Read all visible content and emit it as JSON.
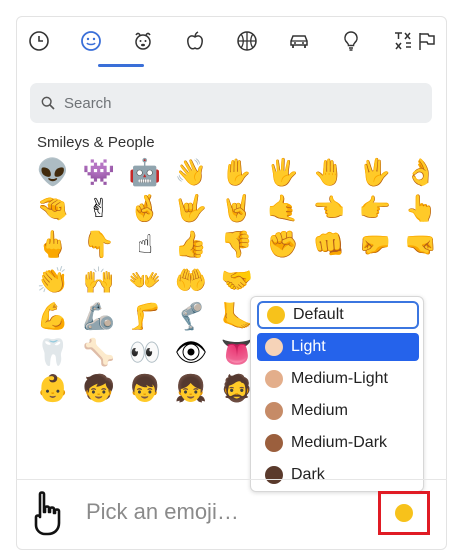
{
  "categories": [
    {
      "name": "recent-icon",
      "label": "Recent"
    },
    {
      "name": "smiley-icon",
      "label": "Smileys & People",
      "active": true
    },
    {
      "name": "animal-icon",
      "label": "Animals & Nature"
    },
    {
      "name": "food-icon",
      "label": "Food & Drink"
    },
    {
      "name": "activity-icon",
      "label": "Activity"
    },
    {
      "name": "travel-icon",
      "label": "Travel & Places"
    },
    {
      "name": "objects-icon",
      "label": "Objects"
    },
    {
      "name": "symbols-icon",
      "label": "Symbols"
    },
    {
      "name": "flags-icon",
      "label": "Flags"
    }
  ],
  "search": {
    "placeholder": "Search"
  },
  "section_title": "Smileys & People",
  "emoji_rows": [
    [
      "👽",
      "👾",
      "🤖",
      "👋",
      "✋",
      "🖐",
      "🤚",
      "🖖",
      "👌"
    ],
    [
      "🤏",
      "✌",
      "🤞",
      "🤟",
      "🤘",
      "🤙",
      "👈",
      "👉",
      "👆"
    ],
    [
      "🖕",
      "👇",
      "☝",
      "👍",
      "👎",
      "✊",
      "👊",
      "🤛",
      "🤜"
    ],
    [
      "👏",
      "🙌",
      "👐",
      "🤲",
      "🤝",
      "",
      "",
      "",
      ""
    ],
    [
      "💪",
      "🦾",
      "🦵",
      "🦿",
      "🦶",
      "",
      "",
      "",
      ""
    ],
    [
      "🦷",
      "🦴",
      "👀",
      "👁",
      "👅",
      "",
      "",
      "",
      ""
    ],
    [
      "👶",
      "🧒",
      "👦",
      "👧",
      "🧔",
      "",
      "",
      "",
      ""
    ]
  ],
  "tone_menu": {
    "items": [
      {
        "label": "Default",
        "color": "#f7c21b",
        "state": "focused"
      },
      {
        "label": "Light",
        "color": "#f6d3b8",
        "state": "selected"
      },
      {
        "label": "Medium-Light",
        "color": "#e3ae8b",
        "state": ""
      },
      {
        "label": "Medium",
        "color": "#c68b67",
        "state": ""
      },
      {
        "label": "Medium-Dark",
        "color": "#9b5f3d",
        "state": ""
      },
      {
        "label": "Dark",
        "color": "#5a3a2c",
        "state": ""
      }
    ]
  },
  "footer": {
    "placeholder_text": "Pick an emoji…",
    "preview_icon": "pointing-up-hand-icon",
    "tone_color": "#f7c21b"
  }
}
